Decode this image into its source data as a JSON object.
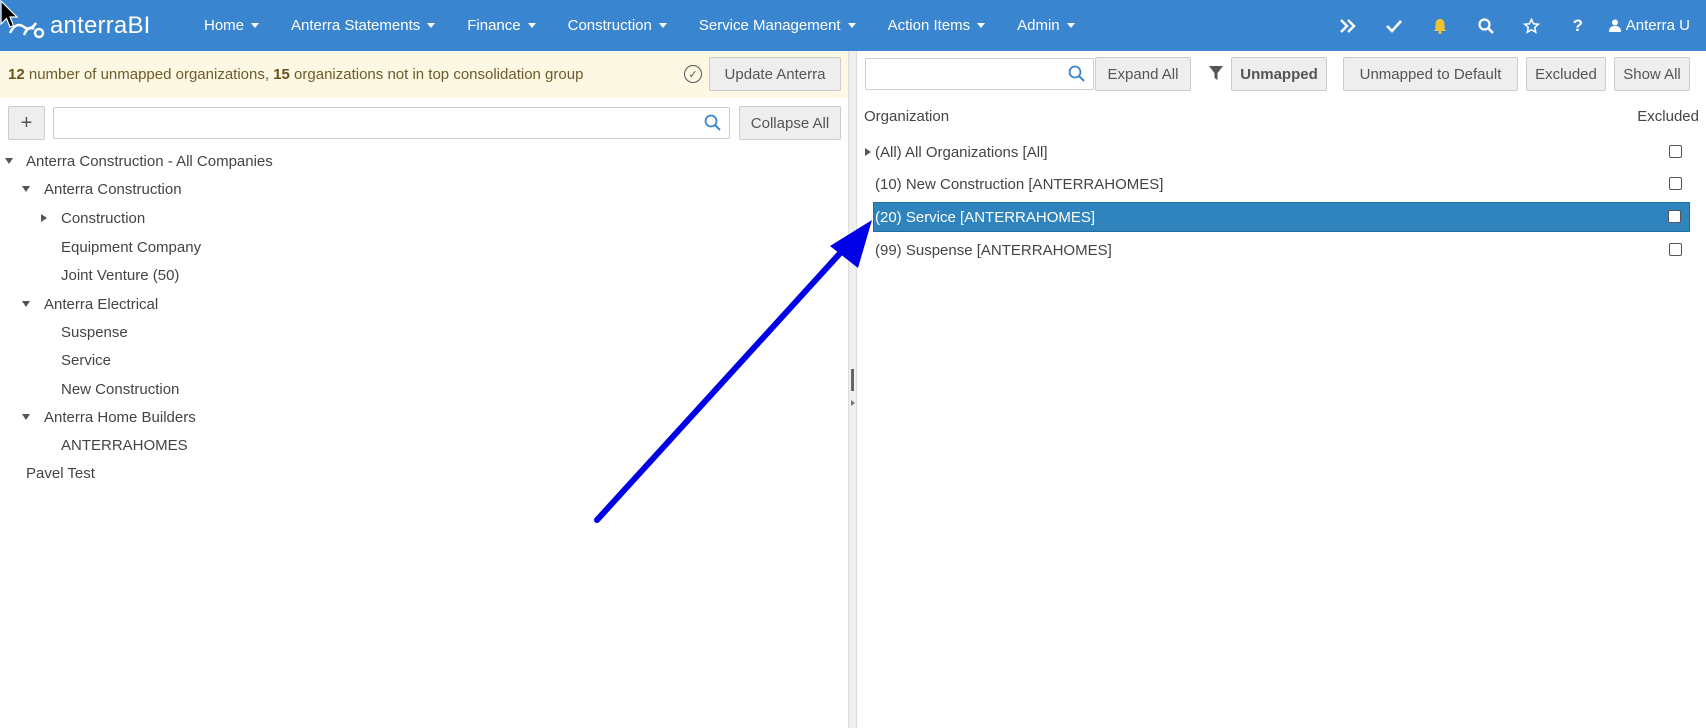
{
  "brand": {
    "name": "anterraBI"
  },
  "nav": {
    "items": [
      {
        "label": "Home"
      },
      {
        "label": "Anterra Statements"
      },
      {
        "label": "Finance"
      },
      {
        "label": "Construction"
      },
      {
        "label": "Service Management"
      },
      {
        "label": "Action Items"
      },
      {
        "label": "Admin"
      }
    ],
    "icons": [
      "double-chevron-right-icon",
      "check-icon",
      "bell-icon",
      "search-icon",
      "star-icon",
      "question-icon"
    ],
    "user": "Anterra U"
  },
  "notice": {
    "unmapped_count": "12",
    "unmapped_text": "number of unmapped organizations,",
    "not_in_group_count": "15",
    "not_in_group_text": "organizations not in top consolidation group"
  },
  "left": {
    "update_button": "Update Anterra",
    "add_button": "+",
    "search": {
      "value": "",
      "placeholder": ""
    },
    "collapse_button": "Collapse All",
    "tree": [
      {
        "label": "Anterra Construction - All Companies",
        "level": 0,
        "state": "expanded"
      },
      {
        "label": "Anterra Construction",
        "level": 1,
        "state": "expanded"
      },
      {
        "label": "Construction",
        "level": 2,
        "state": "collapsed"
      },
      {
        "label": "Equipment Company",
        "level": 2,
        "state": "leaf"
      },
      {
        "label": "Joint Venture (50)",
        "level": 2,
        "state": "leaf"
      },
      {
        "label": "Anterra Electrical",
        "level": 1,
        "state": "expanded"
      },
      {
        "label": "Suspense",
        "level": 2,
        "state": "leaf"
      },
      {
        "label": "Service",
        "level": 2,
        "state": "leaf"
      },
      {
        "label": "New Construction",
        "level": 2,
        "state": "leaf"
      },
      {
        "label": "Anterra Home Builders",
        "level": 1,
        "state": "expanded"
      },
      {
        "label": "ANTERRAHOMES",
        "level": 2,
        "state": "leaf"
      },
      {
        "label": "Pavel Test",
        "level": 0,
        "state": "leaf"
      }
    ]
  },
  "right": {
    "search": {
      "value": "",
      "placeholder": ""
    },
    "expand_button": "Expand All",
    "filter_unmapped": "Unmapped",
    "unmapped_default_button": "Unmapped to Default",
    "excluded_button": "Excluded",
    "show_all_button": "Show All",
    "columns": {
      "organization": "Organization",
      "excluded": "Excluded"
    },
    "rows": [
      {
        "label": "(All) All Organizations [All]",
        "expandable": true,
        "selected": false,
        "excluded": false
      },
      {
        "label": "(10) New Construction [ANTERRAHOMES]",
        "expandable": false,
        "selected": false,
        "excluded": false
      },
      {
        "label": "(20) Service [ANTERRAHOMES]",
        "expandable": false,
        "selected": true,
        "excluded": false
      },
      {
        "label": "(99) Suspense [ANTERRAHOMES]",
        "expandable": false,
        "selected": false,
        "excluded": false
      }
    ]
  },
  "colors": {
    "nav": "#3a85cf",
    "notice_bg": "#fcf8e3",
    "selected_row": "#2f84bd",
    "annotation_arrow": "#0000e6"
  }
}
